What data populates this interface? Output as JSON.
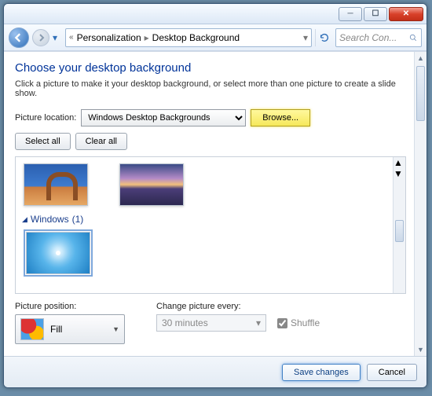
{
  "window": {
    "title": ""
  },
  "nav": {
    "crumb_prefix": "«",
    "crumb1": "Personalization",
    "crumb2": "Desktop Background",
    "search_placeholder": "Search Con..."
  },
  "page": {
    "heading": "Choose your desktop background",
    "subtext": "Click a picture to make it your desktop background, or select more than one picture to create a slide show."
  },
  "picture_location": {
    "label": "Picture location:",
    "selected": "Windows Desktop Backgrounds",
    "browse": "Browse..."
  },
  "buttons": {
    "select_all": "Select all",
    "clear_all": "Clear all"
  },
  "gallery": {
    "group_name": "Windows",
    "group_count": "(1)"
  },
  "picture_position": {
    "label": "Picture position:",
    "selected": "Fill"
  },
  "change_every": {
    "label": "Change picture every:",
    "selected": "30 minutes",
    "shuffle_label": "Shuffle",
    "shuffle_checked": true
  },
  "footer": {
    "save": "Save changes",
    "cancel": "Cancel"
  }
}
